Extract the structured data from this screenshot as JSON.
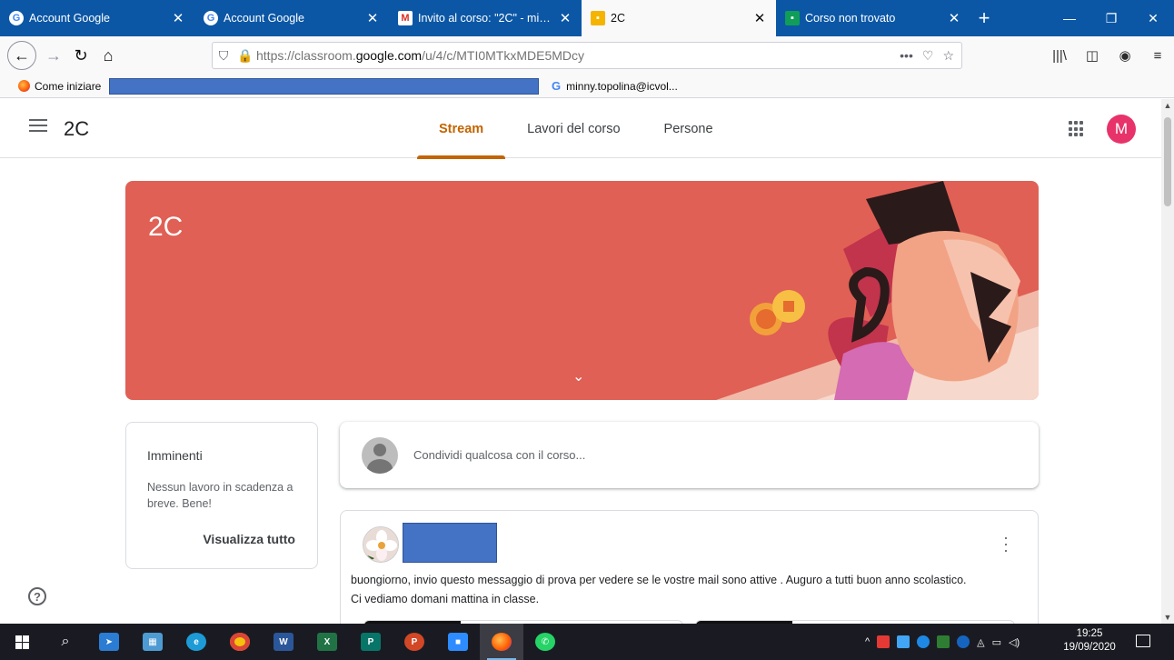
{
  "browser": {
    "tabs": [
      {
        "label": "Account Google",
        "favicon": "google-g-icon",
        "active": false
      },
      {
        "label": "Account Google",
        "favicon": "google-g-icon",
        "active": false
      },
      {
        "label": "Invito al corso: \"2C\" - minny.t",
        "favicon": "gmail-icon",
        "active": false
      },
      {
        "label": "2C",
        "favicon": "classroom-icon",
        "active": true
      },
      {
        "label": "Corso non trovato",
        "favicon": "classroom-icon",
        "active": false
      }
    ],
    "url_prefix": "https://classroom.",
    "url_domain": "google.com",
    "url_suffix": "/u/4/c/MTI0MTkxMDE5MDcy",
    "bookmarks": {
      "first": "Come iniziare",
      "account": "minny.topolina@icvol..."
    }
  },
  "classroom": {
    "course_name": "2C",
    "tabs": [
      {
        "label": "Stream",
        "active": true
      },
      {
        "label": "Lavori del corso",
        "active": false
      },
      {
        "label": "Persone",
        "active": false
      }
    ],
    "avatar_letter": "M",
    "banner_title": "2C",
    "banner_color": "#e06055",
    "accent_color": "#c26401",
    "upcoming": {
      "title": "Imminenti",
      "text": "Nessun lavoro in scadenza a breve. Bene!",
      "link": "Visualizza tutto"
    },
    "share_placeholder": "Condividi qualcosa con il corso...",
    "post": {
      "text_line1": "buongiorno,  invio questo messaggio di prova per vedere se le vostre mail sono attive . Auguro a tutti buon anno scolastico.",
      "text_line2": "Ci vediamo domani mattina in classe."
    }
  },
  "taskbar": {
    "time": "19:25",
    "date": "19/09/2020"
  }
}
